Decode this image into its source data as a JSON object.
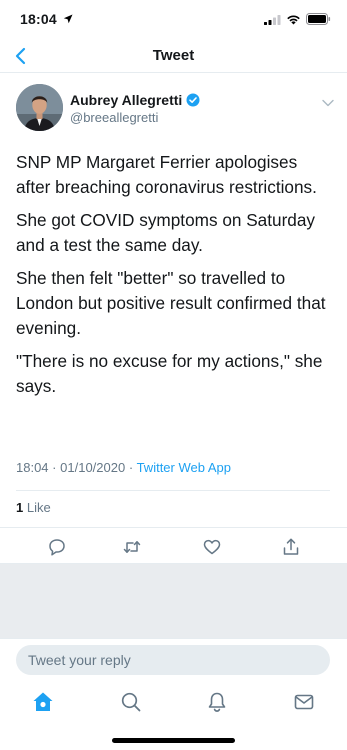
{
  "status_bar": {
    "time": "18:04"
  },
  "nav": {
    "title": "Tweet"
  },
  "author": {
    "name": "Aubrey Allegretti",
    "handle": "@breeallegretti",
    "verified": true
  },
  "tweet": {
    "paragraphs": [
      "SNP MP Margaret Ferrier apologises after breaching coronavirus restrictions.",
      "She got COVID symptoms on Saturday and a test the same day.",
      "She then felt \"better\" so travelled to London but positive result confirmed that evening.",
      "\"There is no excuse for my actions,\" she says."
    ],
    "time": "18:04",
    "date": "01/10/2020",
    "separator": "·",
    "source": "Twitter Web App"
  },
  "stats": {
    "likes_count": "1",
    "likes_label": "Like"
  },
  "actions": {
    "icons": [
      "reply-icon",
      "retweet-icon",
      "like-icon",
      "share-icon"
    ]
  },
  "reply": {
    "placeholder": "Tweet your reply"
  },
  "tab_bar": {
    "icons": [
      "home-icon",
      "search-icon",
      "notifications-icon",
      "messages-icon"
    ]
  },
  "colors": {
    "accent": "#1da1f2",
    "text": "#14171a",
    "muted": "#657786",
    "border": "#e6ecf0",
    "background_gray": "#e9ecef"
  }
}
